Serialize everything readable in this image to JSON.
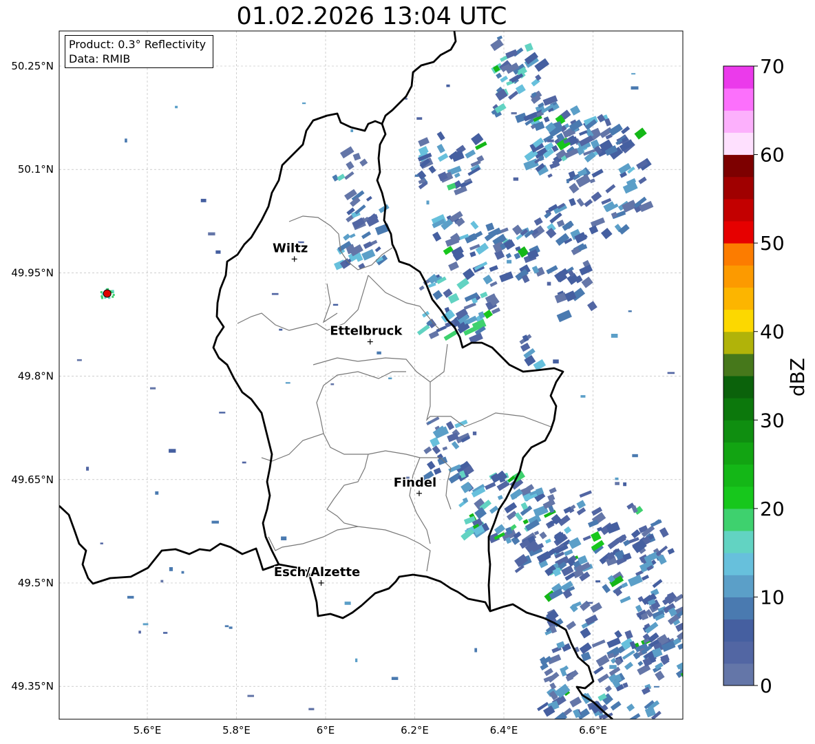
{
  "title": "01.02.2026 13:04 UTC",
  "info": {
    "product": "Product: 0.3° Reflectivity",
    "data": "Data: RMIB"
  },
  "axes": {
    "lon_ticks": [
      "5.6°E",
      "5.8°E",
      "6°E",
      "6.2°E",
      "6.4°E",
      "6.6°E"
    ],
    "lat_ticks": [
      "50.25°N",
      "50.1°N",
      "49.95°N",
      "49.8°N",
      "49.65°N",
      "49.5°N",
      "49.35°N"
    ]
  },
  "cities": [
    {
      "name": "Wiltz",
      "lon": 5.93,
      "lat": 49.97
    },
    {
      "name": "Ettelbruck",
      "lon": 6.1,
      "lat": 49.85
    },
    {
      "name": "Findel",
      "lon": 6.21,
      "lat": 49.63
    },
    {
      "name": "Esch/Alzette",
      "lon": 5.99,
      "lat": 49.5
    }
  ],
  "colorbar": {
    "label": "dBZ",
    "ticks": [
      "0",
      "10",
      "20",
      "30",
      "40",
      "50",
      "60",
      "70"
    ],
    "min": 0,
    "max": 70,
    "step": 2.5,
    "colors": [
      "#6476a8",
      "#5266a3",
      "#455fa0",
      "#4a7ab0",
      "#5b9fc8",
      "#67c0dc",
      "#62d3c2",
      "#3ed16e",
      "#17c71c",
      "#14b717",
      "#12a412",
      "#0f8e10",
      "#0c780c",
      "#0b620b",
      "#46781b",
      "#b1b309",
      "#fcd800",
      "#fcb500",
      "#fc9a00",
      "#fc7c00",
      "#e60000",
      "#c30000",
      "#a00000",
      "#7d0000",
      "#fee0fe",
      "#fcb0fc",
      "#fc70fc",
      "#eb3aeb"
    ]
  },
  "radar_marker": {
    "lon": 5.51,
    "lat": 49.92,
    "color": "#e00000"
  }
}
